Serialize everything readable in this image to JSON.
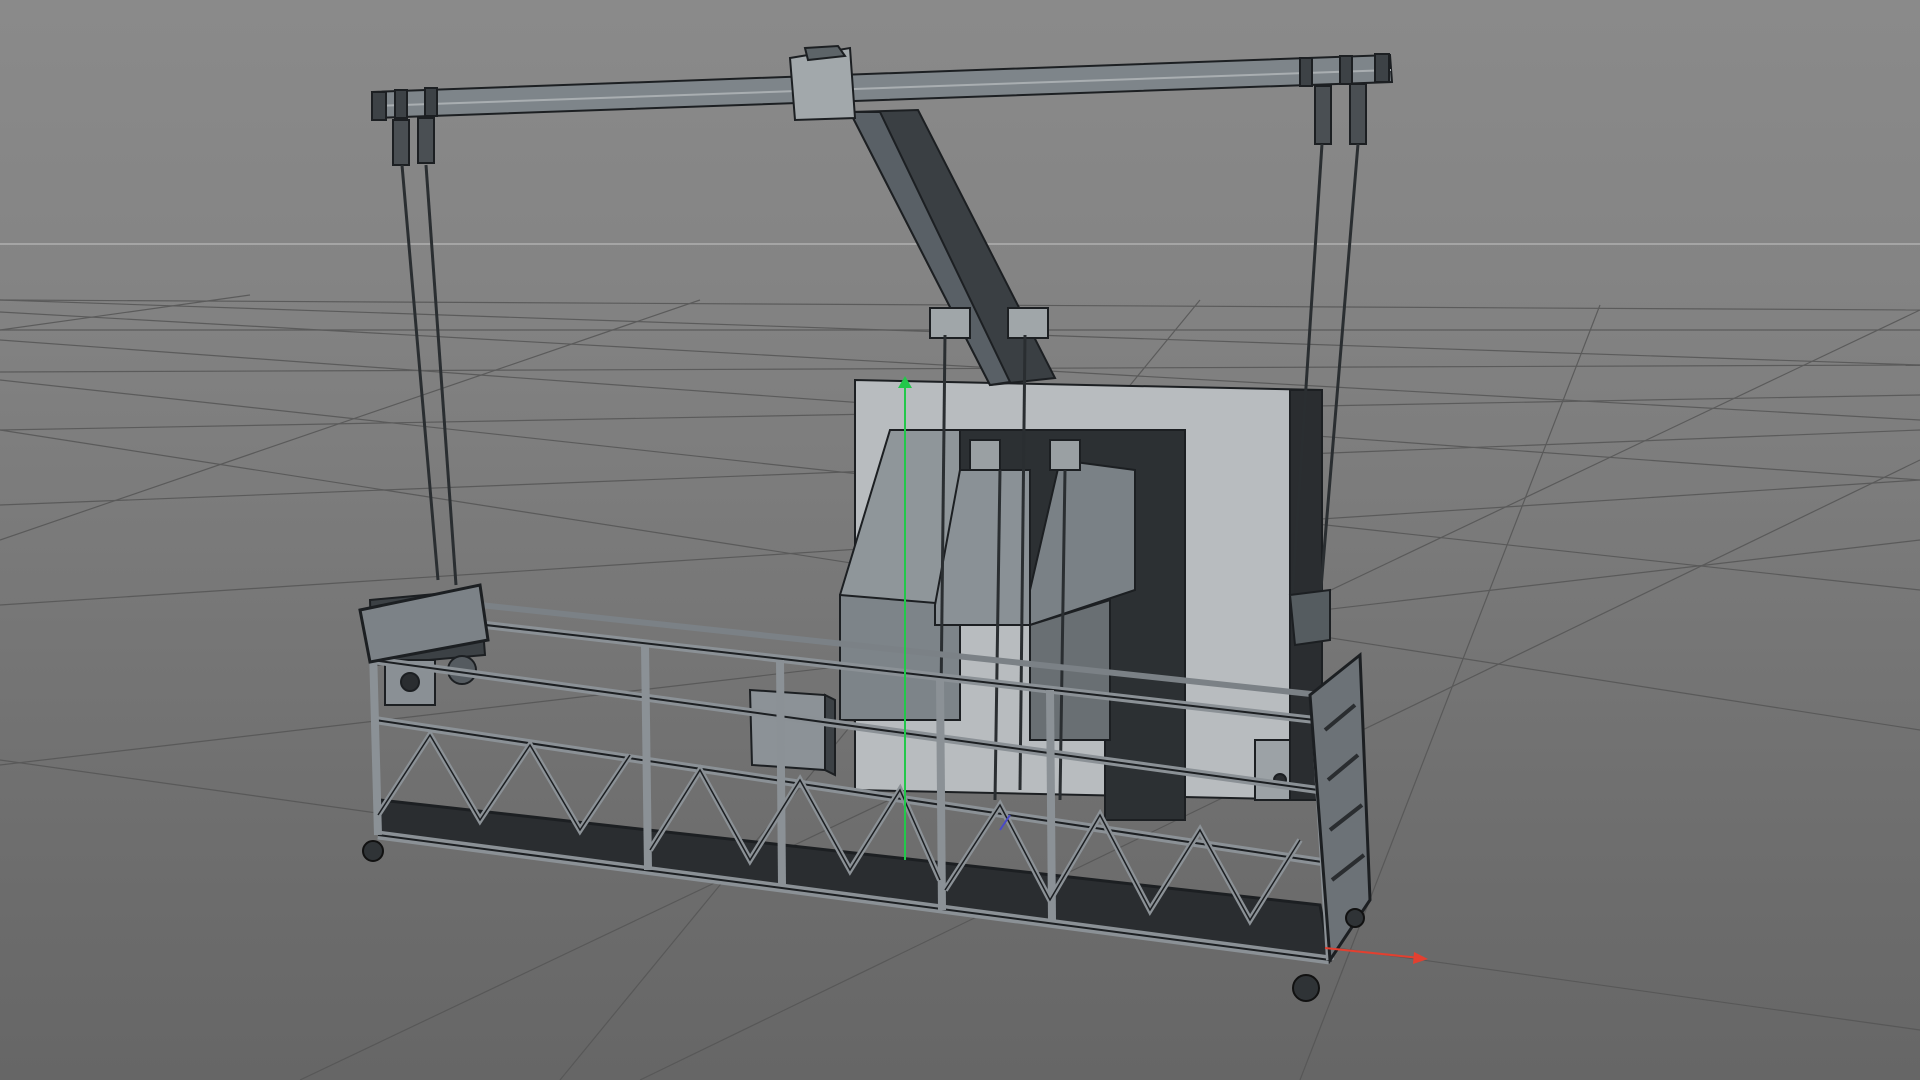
{
  "viewport": {
    "background": "#7b7b7b",
    "grid_color": "#5a5a5a",
    "horizon_color": "#b0b0b0",
    "model_outline": "#1c1f22",
    "metal_fill": "#7f868b",
    "metal_dark": "#2f3336",
    "metal_light": "#aeb3b6",
    "axes": {
      "y": "#22c84a",
      "x": "#e24030",
      "z": "#4a4ac8"
    },
    "objects": {
      "outrigger": "outrigger-beam",
      "cables": "suspension-wire-ropes",
      "counterweight": "counterweight-panel",
      "cradle": "suspended-platform-cradle",
      "wheels": "caster-wheels"
    }
  }
}
